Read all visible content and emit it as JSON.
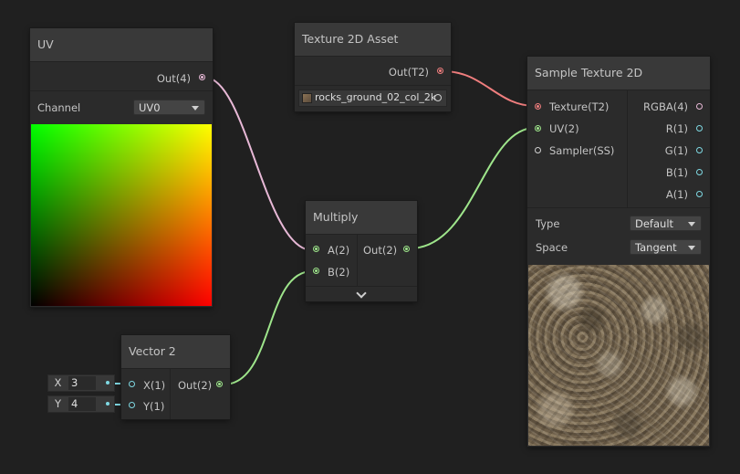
{
  "colors": {
    "canvas": "#202020",
    "node_body": "#2b2b2b",
    "node_header": "#393939",
    "vector4_wire": "#e7b8d6",
    "texture_wire": "#f07e7e",
    "vector2_wire": "#9ee58b",
    "vector1_wire": "#7fd9e3",
    "sampler_port": "#cfcfcf"
  },
  "uv_node": {
    "title": "UV",
    "out_label": "Out(4)",
    "channel_label": "Channel",
    "channel_value": "UV0",
    "preview": "uv-gradient"
  },
  "texture_asset_node": {
    "title": "Texture 2D Asset",
    "out_label": "Out(T2)",
    "texture_name": "rocks_ground_02_col_2k"
  },
  "multiply_node": {
    "title": "Multiply",
    "input_a": "A(2)",
    "input_b": "B(2)",
    "out_label": "Out(2)"
  },
  "vector2_node": {
    "title": "Vector 2",
    "input_x": "X(1)",
    "input_y": "Y(1)",
    "out_label": "Out(2)",
    "x_axis": "X",
    "x_value": "3",
    "y_axis": "Y",
    "y_value": "4"
  },
  "sample_texture_node": {
    "title": "Sample Texture 2D",
    "inputs": [
      "Texture(T2)",
      "UV(2)",
      "Sampler(SS)"
    ],
    "outputs": [
      "RGBA(4)",
      "R(1)",
      "G(1)",
      "B(1)",
      "A(1)"
    ],
    "type_label": "Type",
    "type_value": "Default",
    "space_label": "Space",
    "space_value": "Tangent",
    "preview": "rock-texture"
  }
}
